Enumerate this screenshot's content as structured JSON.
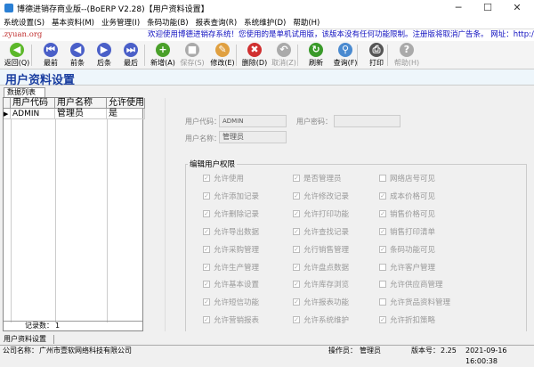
{
  "window": {
    "title": "博德进销存商业版--(BoERP V2.28)【用户资料设置】",
    "minimize": "─",
    "maximize": "☐",
    "close": "✕"
  },
  "menu": [
    "系统设置(S)",
    "基本资料(M)",
    "业务管理(I)",
    "条码功能(B)",
    "报表查询(R)",
    "系统维护(D)",
    "帮助(H)"
  ],
  "ad": {
    "site": ".zyuan.org",
    "message": "欢迎使用博德进销存系统！您使用的是单机试用版，该版本没有任何功能限制。注册版将取消广告条。 网址：http://erp"
  },
  "toolbar": [
    {
      "label": "返回(Q)",
      "icon": "back-arrow-icon",
      "color": "#5cb82a",
      "glyph": "◀",
      "enabled": true
    },
    {
      "label": "最前",
      "icon": "first-icon",
      "color": "#4a5fc8",
      "glyph": "⏮",
      "enabled": true
    },
    {
      "label": "前条",
      "icon": "prev-icon",
      "color": "#4a5fc8",
      "glyph": "◀",
      "enabled": true
    },
    {
      "label": "后条",
      "icon": "next-icon",
      "color": "#4a5fc8",
      "glyph": "▶",
      "enabled": true
    },
    {
      "label": "最后",
      "icon": "last-icon",
      "color": "#4a5fc8",
      "glyph": "⏭",
      "enabled": true
    },
    {
      "label": "新增(A)",
      "icon": "add-icon",
      "color": "#4aa02a",
      "glyph": "+",
      "enabled": true
    },
    {
      "label": "保存(S)",
      "icon": "save-icon",
      "color": "#aaaaaa",
      "glyph": "■",
      "enabled": false
    },
    {
      "label": "修改(E)",
      "icon": "edit-icon",
      "color": "#e0a040",
      "glyph": "✎",
      "enabled": true
    },
    {
      "label": "删除(D)",
      "icon": "delete-icon",
      "color": "#d03030",
      "glyph": "✖",
      "enabled": true
    },
    {
      "label": "取消(Z)",
      "icon": "undo-icon",
      "color": "#aaaaaa",
      "glyph": "↶",
      "enabled": false
    },
    {
      "label": "刷新",
      "icon": "refresh-icon",
      "color": "#3a9a2a",
      "glyph": "↻",
      "enabled": true
    },
    {
      "label": "查询(F)",
      "icon": "search-icon",
      "color": "#4a8ad0",
      "glyph": "⚲",
      "enabled": true
    },
    {
      "label": "打印",
      "icon": "print-icon",
      "color": "#555555",
      "glyph": "⎙",
      "enabled": true
    },
    {
      "label": "帮助(H)",
      "icon": "help-icon",
      "color": "#aaaaaa",
      "glyph": "?",
      "enabled": false
    }
  ],
  "page_title": "用户资料设置",
  "list_tab": "数据列表",
  "grid": {
    "columns": [
      "用户代码",
      "用户名称",
      "允许使用"
    ],
    "rows": [
      [
        "ADMIN",
        "管理员",
        "是"
      ]
    ],
    "record_label": "记录数：",
    "record_count": "1"
  },
  "form": {
    "code_label": "用户代码：",
    "code_value": "ADMIN",
    "password_label": "用户密码：",
    "password_value": "",
    "name_label": "用户名称：",
    "name_value": "管理员"
  },
  "permissions": {
    "title": "编辑用户权限",
    "items": [
      {
        "label": "允许使用",
        "checked": true
      },
      {
        "label": "是否管理员",
        "checked": true
      },
      {
        "label": "网络店号可见",
        "checked": false
      },
      {
        "label": "允许添加记录",
        "checked": true
      },
      {
        "label": "允许修改记录",
        "checked": true
      },
      {
        "label": "成本价格可见",
        "checked": true
      },
      {
        "label": "允许删除记录",
        "checked": true
      },
      {
        "label": "允许打印功能",
        "checked": true
      },
      {
        "label": "销售价格可见",
        "checked": true
      },
      {
        "label": "允许导出数据",
        "checked": true
      },
      {
        "label": "允许查找记录",
        "checked": true
      },
      {
        "label": "销售打印清单",
        "checked": true
      },
      {
        "label": "允许采购管理",
        "checked": true
      },
      {
        "label": "允行销售管理",
        "checked": true
      },
      {
        "label": "条码功能可见",
        "checked": true
      },
      {
        "label": "允许生产管理",
        "checked": true
      },
      {
        "label": "允许盘点数据",
        "checked": true
      },
      {
        "label": "允许客户管理",
        "checked": false
      },
      {
        "label": "允许基本设置",
        "checked": true
      },
      {
        "label": "允许库存浏览",
        "checked": true
      },
      {
        "label": "允许供应商管理",
        "checked": false
      },
      {
        "label": "允许短信功能",
        "checked": true
      },
      {
        "label": "允许报表功能",
        "checked": true
      },
      {
        "label": "允许货品资料管理",
        "checked": false
      },
      {
        "label": "允许营销报表",
        "checked": true
      },
      {
        "label": "允许系统维护",
        "checked": true
      },
      {
        "label": "允许折扣策略",
        "checked": true
      }
    ]
  },
  "bottom_tab": "用户资料设置",
  "status": {
    "company_label": "公司名称：",
    "company": "广州市壹软网络科技有限公司",
    "operator_label": "操作员：",
    "operator": "管理员",
    "version_label": "版本号：",
    "version": "2.25",
    "datetime": "2021-09-16 16:00:38"
  }
}
